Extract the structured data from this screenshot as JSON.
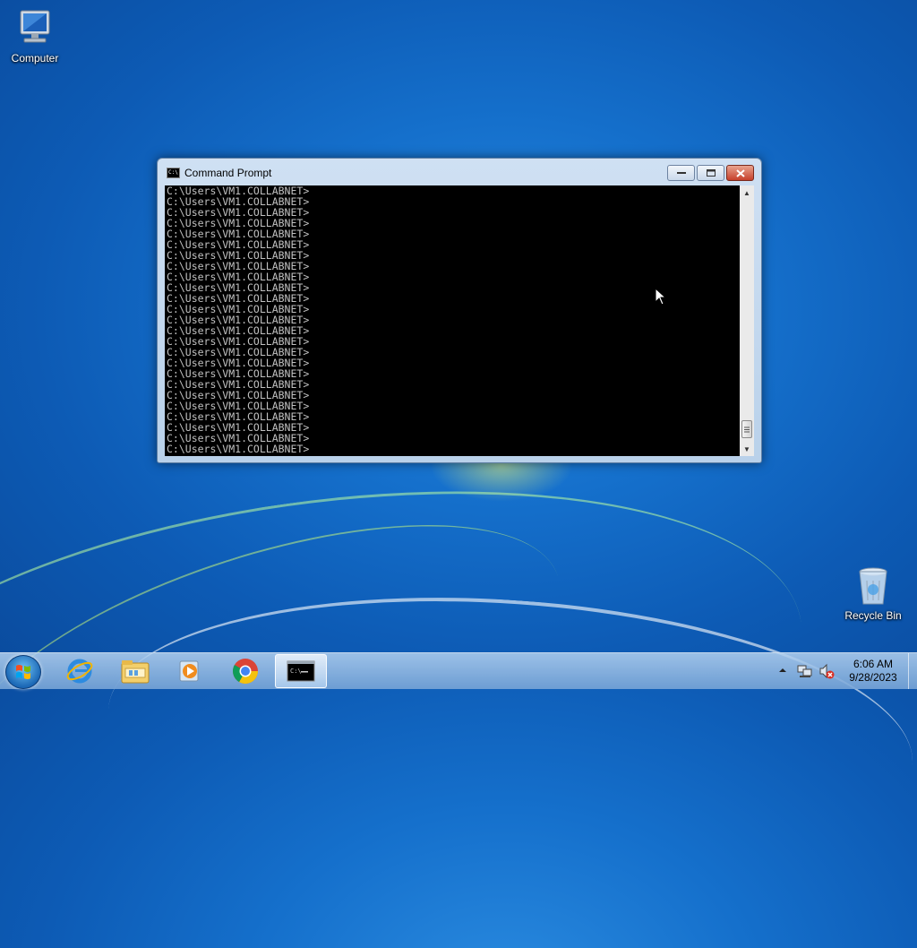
{
  "desktop": {
    "icons": [
      {
        "label": "Computer"
      },
      {
        "label": "Recycle Bin"
      }
    ]
  },
  "window": {
    "title": "Command Prompt",
    "console_line": "C:\\Users\\VM1.COLLABNET>",
    "console_line_count": 25
  },
  "taskbar": {
    "pinned": [
      "internet-explorer-icon",
      "windows-explorer-icon",
      "windows-media-player-icon",
      "chrome-icon",
      "command-prompt-icon"
    ],
    "clock": {
      "time": "6:06 AM",
      "date": "9/28/2023"
    }
  },
  "colors": {
    "console_bg": "#000000",
    "console_text": "#c0c0c0",
    "close_button": "#c6402b"
  }
}
